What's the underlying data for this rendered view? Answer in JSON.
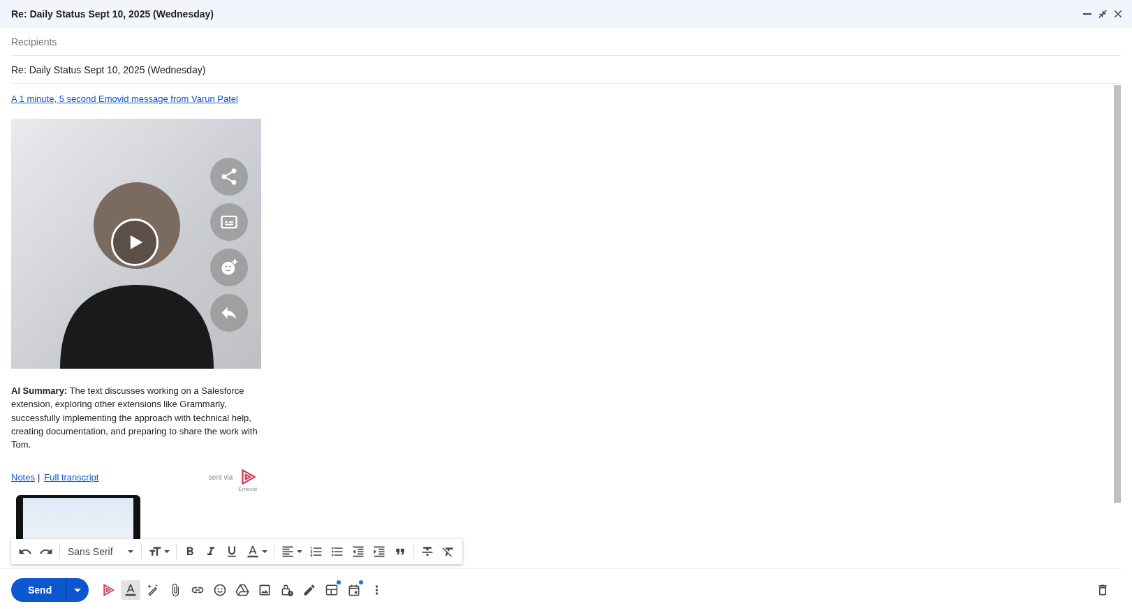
{
  "window": {
    "title": "Re: Daily Status Sept 10, 2025 (Wednesday)",
    "controls": [
      {
        "kind": "minimize"
      },
      {
        "kind": "exit-fullscreen"
      },
      {
        "kind": "close"
      }
    ]
  },
  "recipients": {
    "placeholder": "Recipients"
  },
  "subject": {
    "value": "Re: Daily Status Sept 10, 2025 (Wednesday)"
  },
  "message": {
    "video_link": "A 1 minute, 5 second Emovid message from Varun Patel",
    "overlay_buttons": [
      {
        "kind": "share"
      },
      {
        "kind": "captions"
      },
      {
        "kind": "react"
      },
      {
        "kind": "reply"
      }
    ],
    "summary": "**AI Summary:** The text discusses working on a Salesforce extension, exploring other extensions like Grammarly, successfully implementing the approach with technical help, creating documentation, and preparing to share the work with Tom.",
    "links": [
      "Notes",
      "Full transcript"
    ],
    "separator": "|",
    "sent_via": "sent via",
    "brand": "Emovid"
  },
  "format_toolbar": {
    "font": "Sans Serif",
    "tools": [
      {
        "kind": "undo"
      },
      {
        "kind": "redo"
      },
      {
        "kind": "font"
      },
      {
        "kind": "size"
      },
      {
        "kind": "bold"
      },
      {
        "kind": "italic"
      },
      {
        "kind": "underline"
      },
      {
        "kind": "color"
      },
      {
        "kind": "align"
      },
      {
        "kind": "numbered"
      },
      {
        "kind": "bulleted"
      },
      {
        "kind": "outdent"
      },
      {
        "kind": "indent"
      },
      {
        "kind": "quote"
      },
      {
        "kind": "strike"
      },
      {
        "kind": "clear"
      }
    ]
  },
  "bottom_bar": {
    "send": "Send",
    "tools": [
      {
        "kind": "emovid",
        "active": false,
        "dot": false
      },
      {
        "kind": "formatting",
        "active": true,
        "dot": false
      },
      {
        "kind": "ai-write",
        "active": false,
        "dot": false
      },
      {
        "kind": "attach",
        "active": false,
        "dot": false
      },
      {
        "kind": "link",
        "active": false,
        "dot": false
      },
      {
        "kind": "emoji",
        "active": false,
        "dot": false
      },
      {
        "kind": "drive",
        "active": false,
        "dot": false
      },
      {
        "kind": "photo",
        "active": false,
        "dot": false
      },
      {
        "kind": "confidential",
        "active": false,
        "dot": false
      },
      {
        "kind": "signature",
        "active": false,
        "dot": false
      },
      {
        "kind": "layouts",
        "active": false,
        "dot": true
      },
      {
        "kind": "schedule",
        "active": false,
        "dot": true
      },
      {
        "kind": "more",
        "active": false,
        "dot": false
      }
    ]
  }
}
